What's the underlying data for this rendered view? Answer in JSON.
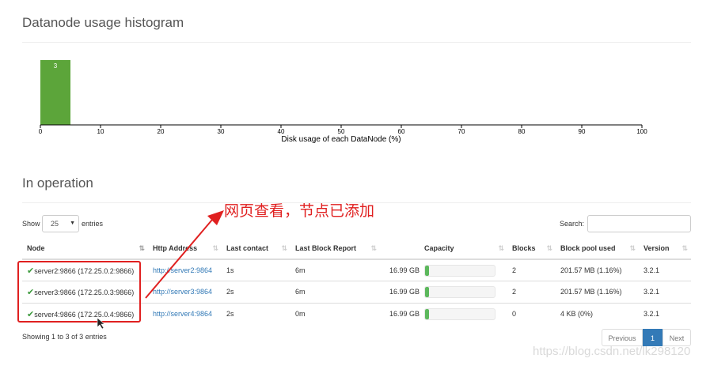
{
  "histogram": {
    "title": "Datanode usage histogram",
    "chart_data": {
      "type": "bar",
      "bins": [
        {
          "x_start": 0,
          "x_end": 5,
          "value": 3
        }
      ],
      "data_labels": [
        "3"
      ],
      "xlabel": "Disk usage of each DataNode (%)",
      "ylabel": "",
      "xlim": [
        0,
        100
      ],
      "xticks": [
        "0",
        "10",
        "20",
        "30",
        "40",
        "50",
        "60",
        "70",
        "80",
        "90",
        "100"
      ],
      "bar_color": "#5ca53a",
      "grid": false
    }
  },
  "operation": {
    "title": "In operation",
    "show_label": "Show",
    "entries_value": "25",
    "entries_label": "entries",
    "search_label": "Search:",
    "search_value": "",
    "columns": [
      "Node",
      "Http Address",
      "Last contact",
      "Last Block Report",
      "Capacity",
      "Blocks",
      "Block pool used",
      "Version"
    ],
    "rows": [
      {
        "node": "server2:9866 (172.25.0.2:9866)",
        "http": "http://server2:9864",
        "last_contact": "1s",
        "last_block_report": "6m",
        "capacity": "16.99 GB",
        "used_fraction": 0.06,
        "blocks": "2",
        "block_pool_used": "201.57 MB (1.16%)",
        "version": "3.2.1"
      },
      {
        "node": "server3:9866 (172.25.0.3:9866)",
        "http": "http://server3:9864",
        "last_contact": "2s",
        "last_block_report": "6m",
        "capacity": "16.99 GB",
        "used_fraction": 0.06,
        "blocks": "2",
        "block_pool_used": "201.57 MB (1.16%)",
        "version": "3.2.1"
      },
      {
        "node": "server4:9866 (172.25.0.4:9866)",
        "http": "http://server4:9864",
        "last_contact": "2s",
        "last_block_report": "0m",
        "capacity": "16.99 GB",
        "used_fraction": 0.06,
        "blocks": "0",
        "block_pool_used": "4 KB (0%)",
        "version": "3.2.1"
      }
    ],
    "info": {
      "showing": "Showing",
      "from": "1",
      "to_word": "to",
      "to": "3",
      "of_word": "of",
      "total": "3",
      "entries": "entries"
    },
    "pagination": {
      "previous": "Previous",
      "page": "1",
      "next": "Next"
    }
  },
  "annotation": {
    "text": "网页查看，节点已添加",
    "color": "#e02020"
  },
  "watermark": "https://blog.csdn.net/lk298120"
}
